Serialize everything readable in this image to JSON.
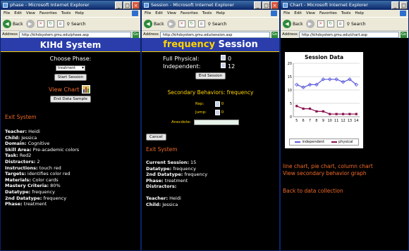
{
  "windows": {
    "phase": {
      "title": "phase - Microsoft Internet Explorer",
      "address": "http://kihdsystem.gmu.edu/phase.asp"
    },
    "session": {
      "title": "Session - Microsoft Internet Explorer",
      "address": "http://kihdsystem.gmu.edu/session.asp"
    },
    "chart": {
      "title": "Chart - Microsoft Internet Explorer",
      "address": "http://kihdsystem.gmu.edu/chart.asp"
    }
  },
  "browser": {
    "menu": [
      "File",
      "Edit",
      "View",
      "Favorites",
      "Tools",
      "Help"
    ],
    "back_label": "Back",
    "search_label": "Search",
    "address_label": "Address",
    "go_label": "Go"
  },
  "phase_page": {
    "banner": "KIHd System",
    "choose_label": "Choose Phase:",
    "phase_value": "treatment",
    "start_button": "Start Session",
    "view_chart": "View Chart",
    "end_sample_button": "End Data Sample",
    "exit": "Exit System",
    "fields": [
      {
        "label": "Teacher:",
        "value": "Heidi"
      },
      {
        "label": "Child:",
        "value": "Jessica"
      },
      {
        "label": "Domain:",
        "value": "Cognitive"
      },
      {
        "label": "Skill Area:",
        "value": "Pre-academic colors"
      },
      {
        "label": "Task:",
        "value": "Red2"
      },
      {
        "label": "Distractors:",
        "value": "2"
      },
      {
        "label": "Instructions:",
        "value": "touch red"
      },
      {
        "label": "Targets:",
        "value": "identifies color red"
      },
      {
        "label": "Materials:",
        "value": "Color cards"
      },
      {
        "label": "Mastery Criteria:",
        "value": "80%"
      },
      {
        "label": "Datatype:",
        "value": "frequency"
      },
      {
        "label": "2nd Datatype:",
        "value": "frequency"
      },
      {
        "label": "Phase:",
        "value": "treatment"
      }
    ]
  },
  "session_page": {
    "banner_word": "frequency",
    "banner_rest": "Session",
    "full_physical_label": "Full Physical:",
    "full_physical_value": "0",
    "independent_label": "Independent:",
    "independent_value": "12",
    "end_session_button": "End Session",
    "secondary_title": "Secondary Behaviors: frequency",
    "rep_label": "Rep:",
    "rep_value": "0",
    "jump_label": "Jump:",
    "jump_value": "0",
    "anecdote_label": "Anecdote:",
    "cancel_button": "Cancel",
    "exit": "Exit System",
    "fields": [
      {
        "label": "Current Session:",
        "value": "15"
      },
      {
        "label": "Datatype:",
        "value": "frequency"
      },
      {
        "label": "2nd Datatype:",
        "value": "frequency"
      },
      {
        "label": "Phase:",
        "value": "treatment"
      },
      {
        "label": "Distractors:",
        "value": ""
      },
      {
        "label": "",
        "value": ""
      },
      {
        "label": "Teacher:",
        "value": "Heidi"
      },
      {
        "label": "Child:",
        "value": "Jessica"
      }
    ]
  },
  "chart_page": {
    "chart_types": "line chart, pie chart, column chart",
    "view_secondary": "View secondary behavior graph",
    "back_link": "Back to data collection"
  },
  "chart_data": {
    "type": "line",
    "title": "Session Data",
    "x": [
      5,
      6,
      7,
      8,
      9,
      10,
      11,
      12,
      13,
      14
    ],
    "ylim": [
      0,
      20
    ],
    "yticks": [
      0,
      5,
      10,
      15,
      20
    ],
    "series": [
      {
        "name": "independent",
        "color": "#5a5adc",
        "values": [
          12,
          11,
          12,
          12,
          14,
          14,
          14,
          13,
          14,
          12
        ]
      },
      {
        "name": "physical",
        "color": "#8a1050",
        "values": [
          4,
          3,
          3,
          2,
          2,
          1,
          1,
          1,
          1,
          1
        ]
      }
    ],
    "legend": "bottom"
  }
}
